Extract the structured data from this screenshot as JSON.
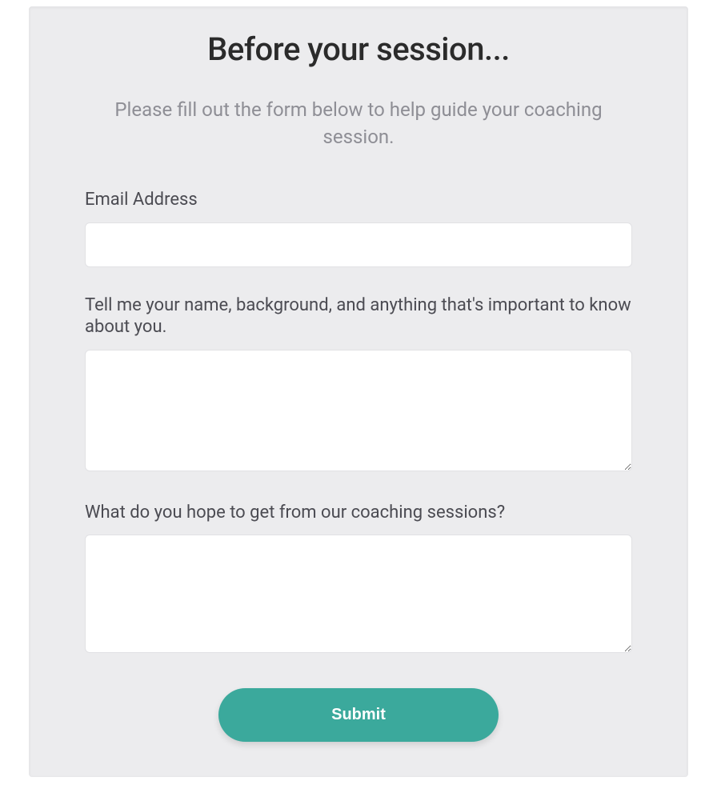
{
  "form": {
    "title": "Before your session...",
    "subtitle": "Please fill out the form below to help guide your coaching session.",
    "fields": {
      "email": {
        "label": "Email Address",
        "value": ""
      },
      "background": {
        "label": "Tell me your name, background, and anything that's important to know about you.",
        "value": ""
      },
      "goals": {
        "label": "What do you hope to get from our coaching sessions?",
        "value": ""
      }
    },
    "submit_label": "Submit"
  }
}
